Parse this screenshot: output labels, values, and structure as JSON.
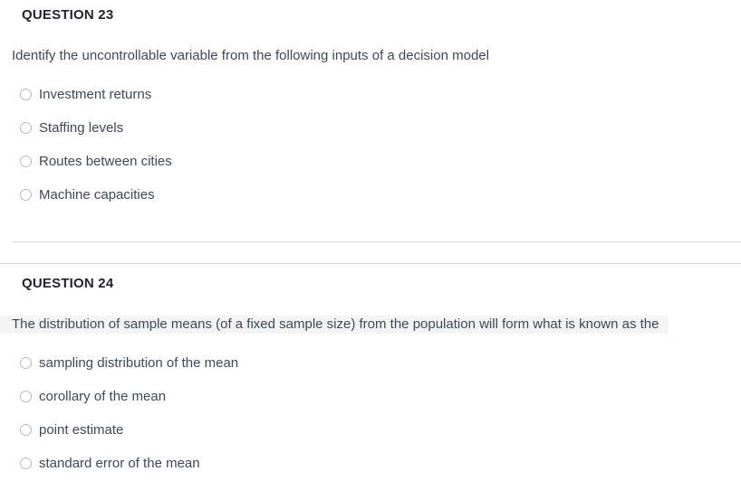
{
  "colors": {
    "page_background": "#ffffff",
    "header_text": "#21252b",
    "body_text": "#3f4856",
    "radio_border": "#b9b9b9",
    "divider": "#d6d6d6",
    "question_highlight": "#f4f4f4"
  },
  "questions": [
    {
      "header": "QUESTION 23",
      "text": "Identify the uncontrollable variable from the following inputs of a decision model",
      "highlighted": false,
      "options": [
        {
          "label": "Investment returns",
          "selected": false
        },
        {
          "label": "Staffing levels",
          "selected": false
        },
        {
          "label": "Routes between cities",
          "selected": false
        },
        {
          "label": "Machine capacities",
          "selected": false
        }
      ]
    },
    {
      "header": "QUESTION 24",
      "text": "The distribution of sample means (of a fixed sample size) from the population will form what is known as the",
      "highlighted": true,
      "options": [
        {
          "label": "sampling distribution of the mean",
          "selected": false
        },
        {
          "label": "corollary of the mean",
          "selected": false
        },
        {
          "label": "point estimate",
          "selected": false
        },
        {
          "label": "standard error of the mean",
          "selected": false
        }
      ]
    }
  ]
}
